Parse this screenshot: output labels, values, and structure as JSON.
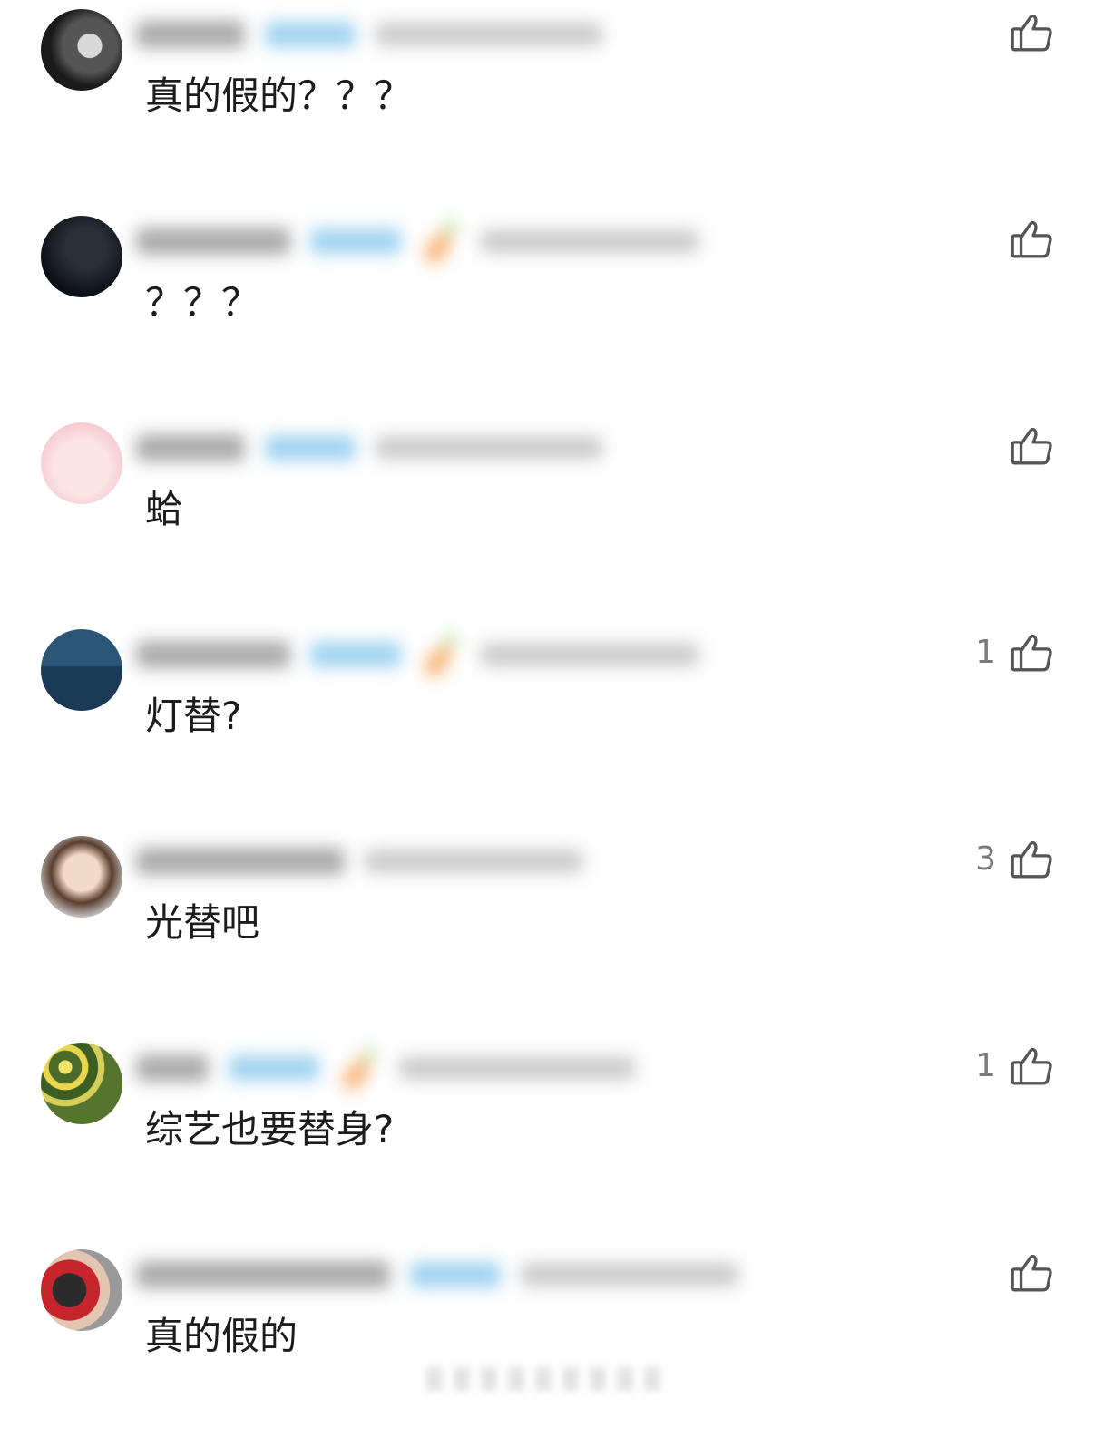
{
  "comments": [
    {
      "text": "真的假的？？？",
      "likes": "",
      "avatar": "dark-portrait-avatar",
      "carrot": false
    },
    {
      "text": "？？？",
      "likes": "",
      "avatar": "black-avatar",
      "carrot": true
    },
    {
      "text": "蛤",
      "likes": "",
      "avatar": "pink-cartoon-avatar",
      "carrot": false
    },
    {
      "text": "灯替?",
      "likes": "1",
      "avatar": "person-by-sea-avatar",
      "carrot": true
    },
    {
      "text": "光替吧",
      "likes": "3",
      "avatar": "smiling-girl-avatar",
      "carrot": false
    },
    {
      "text": "综艺也要替身?",
      "likes": "1",
      "avatar": "yellow-flowers-avatar",
      "carrot": true
    },
    {
      "text": "真的假的",
      "likes": "",
      "avatar": "dog-and-person-avatar",
      "carrot": false
    }
  ],
  "colors": {
    "text": "#1c1c1c",
    "like_icon": "#555555",
    "like_count": "#7a7a7a",
    "badge": "#7fc3ea"
  }
}
